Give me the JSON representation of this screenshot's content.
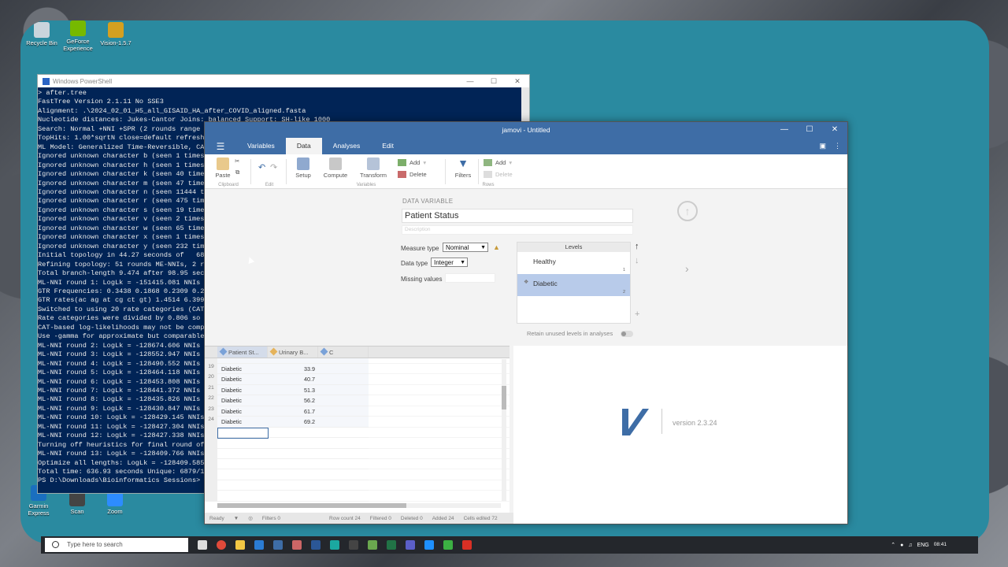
{
  "desktop": {
    "icons": [
      {
        "label": "Recycle Bin",
        "color": "#c9d4dc"
      },
      {
        "label": "GeForce Experience",
        "color": "#76b900"
      },
      {
        "label": "Vision-1.5.7",
        "color": "#d4a020"
      },
      {
        "label": "Garmin Express",
        "color": "#1a6fbf"
      },
      {
        "label": "Scan",
        "color": "#444"
      },
      {
        "label": "Zoom",
        "color": "#2d8cff"
      }
    ]
  },
  "powershell": {
    "title": "Windows PowerShell",
    "lines": [
      "> after.tree",
      "FastTree Version 2.1.11 No SSE3",
      "Alignment: .\\2024_02_01_H5_all_GISAID_HA_after_COVID_aligned.fasta",
      "Nucleotide distances: Jukes-Cantor Joins: balanced Support: SH-like 1000",
      "Search: Normal +NNI +SPR (2 rounds range 1",
      "TopHits: 1.00*sqrtN close=default refresh",
      "ML Model: Generalized Time-Reversible, CAT",
      "Ignored unknown character b (seen 1 times",
      "Ignored unknown character h (seen 1 times",
      "Ignored unknown character k (seen 40 time",
      "Ignored unknown character m (seen 47 time",
      "Ignored unknown character n (seen 11444 t",
      "Ignored unknown character r (seen 475 tim",
      "Ignored unknown character s (seen 19 time",
      "Ignored unknown character v (seen 2 times",
      "Ignored unknown character w (seen 65 time",
      "Ignored unknown character x (seen 1 times",
      "Ignored unknown character y (seen 232 tim",
      "Initial topology in 44.27 seconds of   68",
      "Refining topology: 51 rounds ME-NNIs, 2 r",
      "Total branch-length 9.474 after 98.95 sec",
      "ML-NNI round 1: LogLk = -151415.081 NNIs 3",
      "GTR Frequencies: 0.3438 0.1868 0.2309 0.2",
      "GTR rates(ac ag at cg ct gt) 1.4514 6.399",
      "Switched to using 20 rate categories (CAT",
      "Rate categories were divided by 0.806 so",
      "CAT-based log-likelihoods may not be comp",
      "Use -gamma for approximate but comparable",
      "ML-NNI round 2: LogLk = -128674.606 NNIs",
      "ML-NNI round 3: LogLk = -128552.947 NNIs",
      "ML-NNI round 4: LogLk = -128490.552 NNIs",
      "ML-NNI round 5: LogLk = -128464.118 NNIs",
      "ML-NNI round 6: LogLk = -128453.808 NNIs",
      "ML-NNI round 7: LogLk = -128441.372 NNIs",
      "ML-NNI round 8: LogLk = -128435.826 NNIs",
      "ML-NNI round 9: LogLk = -128430.847 NNIs",
      "ML-NNI round 10: LogLk = -128429.145 NNIs",
      "ML-NNI round 11: LogLk = -128427.304 NNIs",
      "ML-NNI round 12: LogLk = -128427.338 NNIs",
      "Turning off heuristics for final round of",
      "ML-NNI round 13: LogLk = -128409.766 NNIs",
      "Optimize all lengths: LogLk = -128409.585",
      "Total time: 636.93 seconds Unique: 6879/1",
      "PS D:\\Downloads\\Bioinformatics Sessions>"
    ]
  },
  "jamovi": {
    "title": "jamovi - Untitled",
    "tabs": [
      "Variables",
      "Data",
      "Analyses",
      "Edit"
    ],
    "active_tab": "Data",
    "ribbon": {
      "clipboard": {
        "paste": "Paste",
        "group": "Clipboard"
      },
      "edit_group": "Edit",
      "variables": {
        "setup": "Setup",
        "compute": "Compute",
        "transform": "Transform",
        "group": "Variables",
        "add": "Add",
        "delete": "Delete"
      },
      "filters": "Filters",
      "rows": {
        "add": "Add",
        "delete": "Delete",
        "group": "Rows"
      }
    },
    "setup": {
      "section_label": "DATA VARIABLE",
      "name": "Patient Status",
      "description_placeholder": "Description",
      "measure_type_label": "Measure type",
      "measure_type": "Nominal",
      "data_type_label": "Data type",
      "data_type": "Integer",
      "missing_values_label": "Missing values",
      "levels_header": "Levels",
      "levels": [
        {
          "label": "Healthy",
          "value": "1"
        },
        {
          "label": "Diabetic",
          "value": "2"
        }
      ],
      "retain_label": "Retain unused levels in analyses"
    },
    "grid": {
      "columns": [
        "Patient St...",
        "Urinary B...",
        "C"
      ],
      "rows": [
        {
          "n": "19",
          "status": "Diabetic",
          "urinary": "33.9"
        },
        {
          "n": "20",
          "status": "Diabetic",
          "urinary": "40.7"
        },
        {
          "n": "21",
          "status": "Diabetic",
          "urinary": "51.3"
        },
        {
          "n": "22",
          "status": "Diabetic",
          "urinary": "56.2"
        },
        {
          "n": "23",
          "status": "Diabetic",
          "urinary": "61.7"
        },
        {
          "n": "24",
          "status": "Diabetic",
          "urinary": "69.2"
        }
      ]
    },
    "status": {
      "ready": "Ready",
      "filters": "Filters 0",
      "row_count": "Row count 24",
      "filtered": "Filtered 0",
      "deleted": "Deleted 0",
      "added": "Added 24",
      "cells_edited": "Cells edited 72"
    },
    "version": "version 2.3.24"
  },
  "taskbar": {
    "search_placeholder": "Type here to search",
    "lang": "ENG",
    "time": "08:41"
  }
}
